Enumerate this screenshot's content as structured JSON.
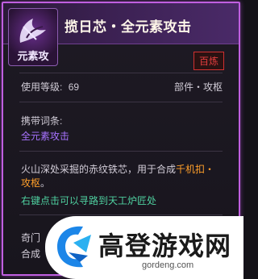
{
  "item": {
    "title": "揽日芯・全元素攻击",
    "emblem_label": "元素攻",
    "quality": "百炼",
    "level_label": "使用等级:",
    "level_value": "69",
    "category": "部件・攻枢",
    "affix_heading": "携带词条:",
    "affix": "全元素攻击",
    "description_prefix": "火山深处采掘的赤纹铁芯，用于合成",
    "description_highlight": "千机扣・攻枢",
    "description_suffix": "。",
    "hint": "右键点击可以寻路到天工炉匠处",
    "truncated_line1": "奇门",
    "truncated_line2": "合成"
  },
  "watermark": {
    "name": "高登游戏网",
    "url": "gordeng.com"
  },
  "colors": {
    "border": "#c05fe0",
    "affix": "#a773ff",
    "highlight": "#ff9f2a",
    "hint": "#4fcf9f",
    "quality": "#e23d3d"
  }
}
